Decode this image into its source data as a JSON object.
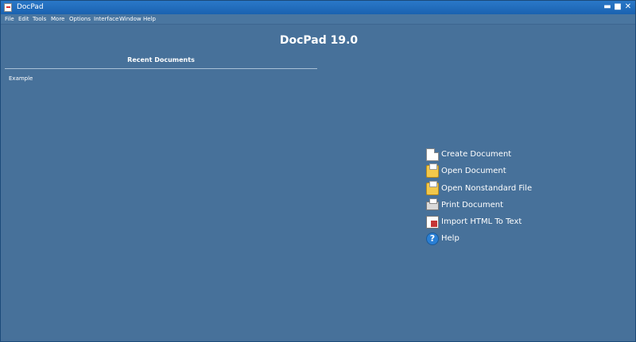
{
  "window": {
    "title": "DocPad"
  },
  "window_controls": {
    "minimize": "▬",
    "maximize": "■",
    "close": "✕"
  },
  "menu": [
    "File",
    "Edit",
    "Tools",
    "More",
    "Options",
    "Interface",
    "Window",
    "Help"
  ],
  "heading": "DocPad 19.0",
  "recent": {
    "title": "Recent Documents",
    "items": [
      "Example"
    ]
  },
  "actions": [
    {
      "label": "Create Document",
      "icon": "new-document-icon"
    },
    {
      "label": "Open Document",
      "icon": "open-folder-icon"
    },
    {
      "label": "Open Nonstandard File",
      "icon": "open-folder-icon"
    },
    {
      "label": "Print Document",
      "icon": "printer-icon"
    },
    {
      "label": "Import HTML To Text",
      "icon": "import-icon"
    },
    {
      "label": "Help",
      "icon": "help-icon",
      "glyph": "?"
    }
  ],
  "colors": {
    "background": "#47719a",
    "titlebar": "#1a62b0",
    "text": "#ffffff"
  }
}
